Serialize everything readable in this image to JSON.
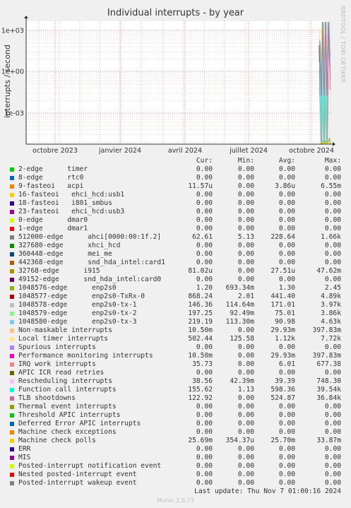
{
  "chart_data": {
    "type": "line",
    "title": "Individual interrupts - by year",
    "ylabel": "interrupts / second",
    "y_scale": "log",
    "y_ticks": [
      "1e+03",
      "1e+00",
      "1e-03"
    ],
    "x_ticks": [
      "octobre 2023",
      "janvier 2024",
      "avril 2024",
      "juillet 2024",
      "octobre 2024"
    ],
    "grid": true,
    "brand": "RRDTOOL / TOBI OETIKER",
    "columns": {
      "cur": "Cur:",
      "min": "Min:",
      "avg": "Avg:",
      "max": "Max:"
    },
    "series": [
      {
        "name": "2-edge      timer",
        "color": "#00cc00",
        "cur": "0.00",
        "min": "0.00",
        "avg": "0.00",
        "max": "0.00"
      },
      {
        "name": "8-edge      rtc0",
        "color": "#0066b3",
        "cur": "0.00",
        "min": "0.00",
        "avg": "0.00",
        "max": "0.00"
      },
      {
        "name": "9-fasteoi   acpi",
        "color": "#ff8000",
        "cur": "11.57u",
        "min": "0.00",
        "avg": "3.86u",
        "max": "6.55m"
      },
      {
        "name": "16-fasteoi   ehci_hcd:usb1",
        "color": "#ffcc00",
        "cur": "0.00",
        "min": "0.00",
        "avg": "0.00",
        "max": "0.00"
      },
      {
        "name": "18-fasteoi   i801_smbus",
        "color": "#330099",
        "cur": "0.00",
        "min": "0.00",
        "avg": "0.00",
        "max": "0.00"
      },
      {
        "name": "23-fasteoi   ehci_hcd:usb3",
        "color": "#990099",
        "cur": "0.00",
        "min": "0.00",
        "avg": "0.00",
        "max": "0.00"
      },
      {
        "name": "0-edge      dmar0",
        "color": "#ccff00",
        "cur": "0.00",
        "min": "0.00",
        "avg": "0.00",
        "max": "0.00"
      },
      {
        "name": "1-edge      dmar1",
        "color": "#ff0000",
        "cur": "0.00",
        "min": "0.00",
        "avg": "0.00",
        "max": "0.00"
      },
      {
        "name": "512000-edge      ahci[0000:00:1f.2]",
        "color": "#808080",
        "cur": "62.61",
        "min": "5.13",
        "avg": "228.64",
        "max": "1.66k"
      },
      {
        "name": "327680-edge      xhci_hcd",
        "color": "#008f00",
        "cur": "0.00",
        "min": "0.00",
        "avg": "0.00",
        "max": "0.00"
      },
      {
        "name": "360448-edge      mei_me",
        "color": "#00487d",
        "cur": "0.00",
        "min": "0.00",
        "avg": "0.00",
        "max": "0.00"
      },
      {
        "name": "442368-edge      snd_hda_intel:card1",
        "color": "#b35a00",
        "cur": "0.00",
        "min": "0.00",
        "avg": "0.00",
        "max": "0.00"
      },
      {
        "name": "32768-edge      i915",
        "color": "#b38f00",
        "cur": "81.02u",
        "min": "0.00",
        "avg": "27.51u",
        "max": "47.62m"
      },
      {
        "name": "49152-edge      snd_hda_intel:card0",
        "color": "#6b006b",
        "cur": "0.00",
        "min": "0.00",
        "avg": "0.00",
        "max": "0.00"
      },
      {
        "name": "1048576-edge      enp2s0",
        "color": "#8fb300",
        "cur": "1.20",
        "min": "693.34m",
        "avg": "1.30",
        "max": "2.45"
      },
      {
        "name": "1048577-edge      enp2s0-TxRx-0",
        "color": "#b30000",
        "cur": "868.24",
        "min": "2.01",
        "avg": "441.40",
        "max": "4.89k"
      },
      {
        "name": "1048578-edge      enp2s0-tx-1",
        "color": "#bebebe",
        "cur": "146.36",
        "min": "114.64m",
        "avg": "171.01",
        "max": "3.97k"
      },
      {
        "name": "1048579-edge      enp2s0-tx-2",
        "color": "#80ff80",
        "cur": "197.25",
        "min": "92.49m",
        "avg": "75.01",
        "max": "3.86k"
      },
      {
        "name": "1048580-edge      enp2s0-tx-3",
        "color": "#80c9ff",
        "cur": "219.19",
        "min": "113.30m",
        "avg": "90.98",
        "max": "4.63k"
      },
      {
        "name": "Non-maskable interrupts",
        "color": "#ffc080",
        "cur": "10.50m",
        "min": "0.00",
        "avg": "29.93m",
        "max": "397.83m"
      },
      {
        "name": "Local timer interrupts",
        "color": "#ffe680",
        "cur": "502.44",
        "min": "125.58",
        "avg": "1.12k",
        "max": "7.72k"
      },
      {
        "name": "Spurious interrupts",
        "color": "#aa80ff",
        "cur": "0.00",
        "min": "0.00",
        "avg": "0.00",
        "max": "0.00"
      },
      {
        "name": "Performance monitoring interrupts",
        "color": "#ee00cc",
        "cur": "10.50m",
        "min": "0.00",
        "avg": "29.93m",
        "max": "397.83m"
      },
      {
        "name": "IRQ work interrupts",
        "color": "#ff8080",
        "cur": "35.73",
        "min": "0.00",
        "avg": "6.01",
        "max": "677.38"
      },
      {
        "name": "APIC ICR read retries",
        "color": "#666600",
        "cur": "0.00",
        "min": "0.00",
        "avg": "0.00",
        "max": "0.00"
      },
      {
        "name": "Rescheduling interrupts",
        "color": "#ffbfff",
        "cur": "38.56",
        "min": "42.39m",
        "avg": "39.39",
        "max": "748.30"
      },
      {
        "name": "Function call interrupts",
        "color": "#00ffcc",
        "cur": "155.62",
        "min": "1.13",
        "avg": "598.36",
        "max": "39.54k"
      },
      {
        "name": "TLB shootdowns",
        "color": "#cc6699",
        "cur": "122.92",
        "min": "0.00",
        "avg": "524.87",
        "max": "36.84k"
      },
      {
        "name": "Thermal event interrupts",
        "color": "#999900",
        "cur": "0.00",
        "min": "0.00",
        "avg": "0.00",
        "max": "0.00"
      },
      {
        "name": "Threshold APIC interrupts",
        "color": "#00cc00",
        "cur": "0.00",
        "min": "0.00",
        "avg": "0.00",
        "max": "0.00"
      },
      {
        "name": "Deferred Error APIC interrupts",
        "color": "#0066b3",
        "cur": "0.00",
        "min": "0.00",
        "avg": "0.00",
        "max": "0.00"
      },
      {
        "name": "Machine check exceptions",
        "color": "#ff8000",
        "cur": "0.00",
        "min": "0.00",
        "avg": "0.00",
        "max": "0.00"
      },
      {
        "name": "Machine check polls",
        "color": "#ffcc00",
        "cur": "25.69m",
        "min": "354.37u",
        "avg": "25.70m",
        "max": "33.87m"
      },
      {
        "name": "ERR",
        "color": "#330099",
        "cur": "0.00",
        "min": "0.00",
        "avg": "0.00",
        "max": "0.00"
      },
      {
        "name": "MIS",
        "color": "#990099",
        "cur": "0.00",
        "min": "0.00",
        "avg": "0.00",
        "max": "0.00"
      },
      {
        "name": "Posted-interrupt notification event",
        "color": "#ccff00",
        "cur": "0.00",
        "min": "0.00",
        "avg": "0.00",
        "max": "0.00"
      },
      {
        "name": "Nested posted-interrupt event",
        "color": "#ff0000",
        "cur": "0.00",
        "min": "0.00",
        "avg": "0.00",
        "max": "0.00"
      },
      {
        "name": "Posted-interrupt wakeup event",
        "color": "#808080",
        "cur": "0.00",
        "min": "0.00",
        "avg": "0.00",
        "max": "0.00"
      }
    ],
    "last_update": "Last update: Thu Nov  7 01:00:16 2024",
    "footer": "Munin 2.0.73"
  }
}
